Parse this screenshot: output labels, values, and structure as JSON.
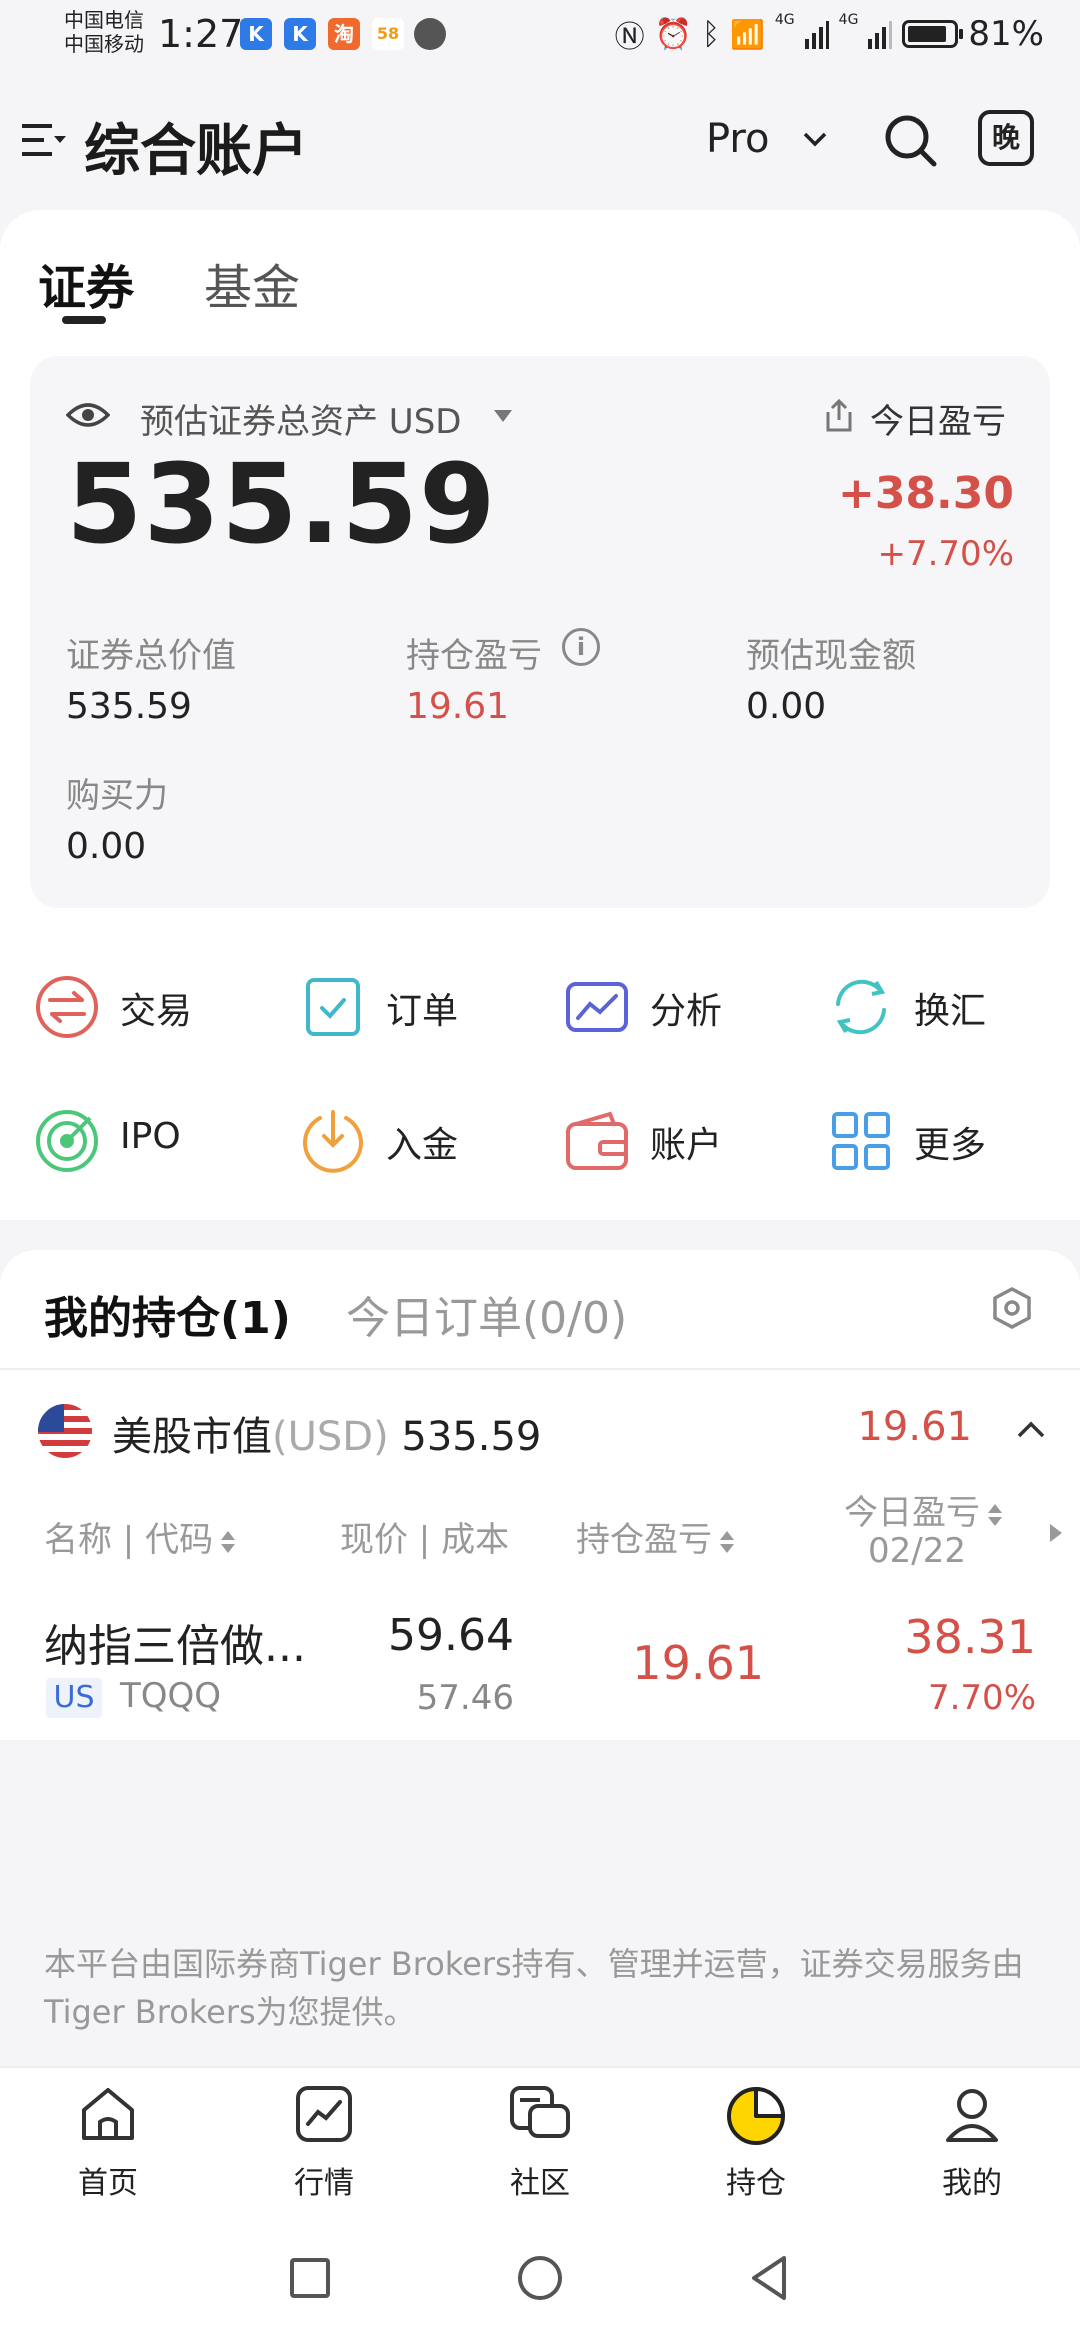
{
  "status_bar": {
    "carrier_1": "中国电信",
    "carrier_2": "中国移动",
    "time": "1:27",
    "network_1": "4G",
    "network_2": "4G",
    "battery": "81%"
  },
  "header": {
    "title": "综合账户",
    "mode": "Pro",
    "night_label": "晚"
  },
  "tabs": [
    "证券",
    "基金"
  ],
  "asset": {
    "label": "预估证券总资产 USD",
    "total": "535.59",
    "today_label": "今日盈亏",
    "today_value": "+38.30",
    "today_percent": "+7.70%",
    "stats": [
      {
        "label": "证券总价值",
        "value": "535.59"
      },
      {
        "label": "持仓盈亏",
        "value": "19.61"
      },
      {
        "label": "预估现金额",
        "value": "0.00"
      },
      {
        "label": "购买力",
        "value": "0.00"
      }
    ]
  },
  "quick_actions": [
    {
      "label": "交易",
      "icon": "trade-icon"
    },
    {
      "label": "订单",
      "icon": "order-icon"
    },
    {
      "label": "分析",
      "icon": "analysis-icon"
    },
    {
      "label": "换汇",
      "icon": "exchange-icon"
    },
    {
      "label": "IPO",
      "icon": "ipo-icon"
    },
    {
      "label": "入金",
      "icon": "deposit-icon"
    },
    {
      "label": "账户",
      "icon": "wallet-icon"
    },
    {
      "label": "更多",
      "icon": "grid-icon"
    }
  ],
  "holdings": {
    "tab_active": "我的持仓(1)",
    "tab_inactive": "今日订单(0/0)",
    "market_label": "美股市值",
    "market_currency": "(USD)",
    "market_value": "535.59",
    "market_pnl": "19.61",
    "columns": {
      "name": "名称 | 代码",
      "price": "现价 | 成本",
      "pnl": "持仓盈亏",
      "today": "今日盈亏",
      "today_date": "02/22"
    },
    "rows": [
      {
        "name": "纳指三倍做...",
        "market": "US",
        "code": "TQQQ",
        "price": "59.64",
        "cost": "57.46",
        "pnl": "19.61",
        "today_value": "38.31",
        "today_percent": "7.70%"
      }
    ]
  },
  "disclaimer": "本平台由国际券商Tiger Brokers持有、管理并运营，证券交易服务由Tiger Brokers为您提供。",
  "bottom_nav": [
    {
      "label": "首页",
      "icon": "home-icon"
    },
    {
      "label": "行情",
      "icon": "chart-icon"
    },
    {
      "label": "社区",
      "icon": "community-icon"
    },
    {
      "label": "持仓",
      "icon": "pie-icon"
    },
    {
      "label": "我的",
      "icon": "profile-icon"
    }
  ],
  "colors": {
    "red": "#d4514a",
    "accent_yellow": "#ffd500"
  }
}
